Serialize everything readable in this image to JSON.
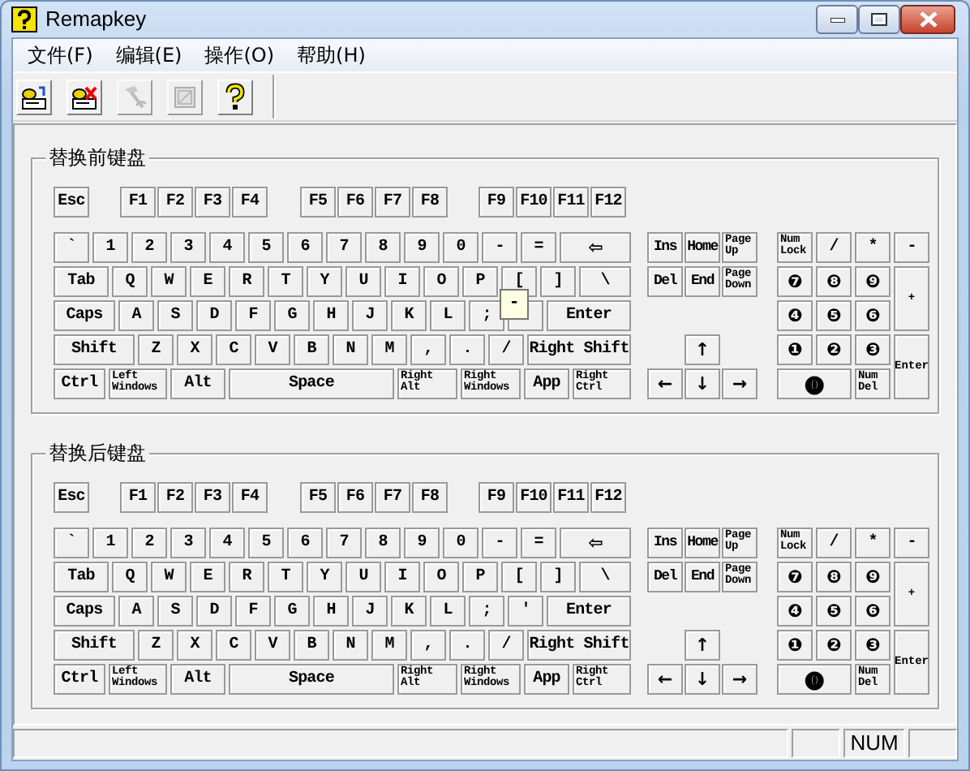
{
  "window": {
    "title": "Remapkey"
  },
  "menu": [
    "文件(F)",
    "编辑(E)",
    "操作(O)",
    "帮助(H)"
  ],
  "toolbar": [
    {
      "kind": "load",
      "disabled": false
    },
    {
      "kind": "clear",
      "disabled": false
    },
    {
      "kind": "restore",
      "disabled": true
    },
    {
      "kind": "view",
      "disabled": true
    },
    {
      "kind": "help",
      "disabled": false
    }
  ],
  "keyboards": [
    {
      "title": "替换前键盘",
      "tooltip": "-",
      "function_row": [
        "Esc",
        "F1",
        "F2",
        "F3",
        "F4",
        "F5",
        "F6",
        "F7",
        "F8",
        "F9",
        "F10",
        "F11",
        "F12"
      ],
      "main_rows": [
        [
          "`",
          "1",
          "2",
          "3",
          "4",
          "5",
          "6",
          "7",
          "8",
          "9",
          "0",
          "-",
          "=",
          "⇦"
        ],
        [
          "Tab",
          "Q",
          "W",
          "E",
          "R",
          "T",
          "Y",
          "U",
          "I",
          "O",
          "P",
          "[",
          "]",
          "\\"
        ],
        [
          "Caps",
          "A",
          "S",
          "D",
          "F",
          "G",
          "H",
          "J",
          "K",
          "L",
          ";",
          {
            "kind": "blank"
          },
          "Enter"
        ],
        [
          "Shift",
          "Z",
          "X",
          "C",
          "V",
          "B",
          "N",
          "M",
          ",",
          ".",
          "/",
          "Right Shift"
        ],
        [
          "Ctrl",
          {
            "label": "Left Windows",
            "kind": "small"
          },
          "Alt",
          "Space",
          {
            "label": "Right Alt",
            "kind": "small"
          },
          {
            "label": "Right Windows",
            "kind": "small"
          },
          "App",
          {
            "label": "Right Ctrl",
            "kind": "small"
          }
        ]
      ],
      "nav": [
        "Ins",
        "Home",
        {
          "label": "Page Up",
          "kind": "small"
        },
        "Del",
        "End",
        {
          "label": "Page Down",
          "kind": "small"
        },
        "↑",
        "←",
        "↓",
        "→"
      ],
      "numpad": [
        {
          "label": "Num Lock",
          "kind": "small"
        },
        "/",
        "*",
        "-",
        "❼",
        "❽",
        "❾",
        {
          "label": "+",
          "kind": "tiny"
        },
        "❹",
        "❺",
        "❻",
        "❶",
        "❷",
        "❸",
        {
          "label": "Enter",
          "kind": "tiny"
        },
        "⓿",
        {
          "label": "Num Del",
          "kind": "small"
        }
      ]
    },
    {
      "title": "替换后键盘",
      "function_row": [
        "Esc",
        "F1",
        "F2",
        "F3",
        "F4",
        "F5",
        "F6",
        "F7",
        "F8",
        "F9",
        "F10",
        "F11",
        "F12"
      ],
      "main_rows": [
        [
          "`",
          "1",
          "2",
          "3",
          "4",
          "5",
          "6",
          "7",
          "8",
          "9",
          "0",
          "-",
          "=",
          "⇦"
        ],
        [
          "Tab",
          "Q",
          "W",
          "E",
          "R",
          "T",
          "Y",
          "U",
          "I",
          "O",
          "P",
          "[",
          "]",
          "\\"
        ],
        [
          "Caps",
          "A",
          "S",
          "D",
          "F",
          "G",
          "H",
          "J",
          "K",
          "L",
          ";",
          "'",
          "Enter"
        ],
        [
          "Shift",
          "Z",
          "X",
          "C",
          "V",
          "B",
          "N",
          "M",
          ",",
          ".",
          "/",
          "Right Shift"
        ],
        [
          "Ctrl",
          {
            "label": "Left Windows",
            "kind": "small"
          },
          "Alt",
          "Space",
          {
            "label": "Right Alt",
            "kind": "small"
          },
          {
            "label": "Right Windows",
            "kind": "small"
          },
          "App",
          {
            "label": "Right Ctrl",
            "kind": "small"
          }
        ]
      ],
      "nav": [
        "Ins",
        "Home",
        {
          "label": "Page Up",
          "kind": "small"
        },
        "Del",
        "End",
        {
          "label": "Page Down",
          "kind": "small"
        },
        "↑",
        "←",
        "↓",
        "→"
      ],
      "numpad": [
        {
          "label": "Num Lock",
          "kind": "small"
        },
        "/",
        "*",
        "-",
        "❼",
        "❽",
        "❾",
        {
          "label": "+",
          "kind": "tiny"
        },
        "❹",
        "❺",
        "❻",
        "❶",
        "❷",
        "❸",
        {
          "label": "Enter",
          "kind": "tiny"
        },
        "⓿",
        {
          "label": "Num Del",
          "kind": "small"
        }
      ]
    }
  ],
  "status_bar": {
    "indicator": "NUM"
  }
}
